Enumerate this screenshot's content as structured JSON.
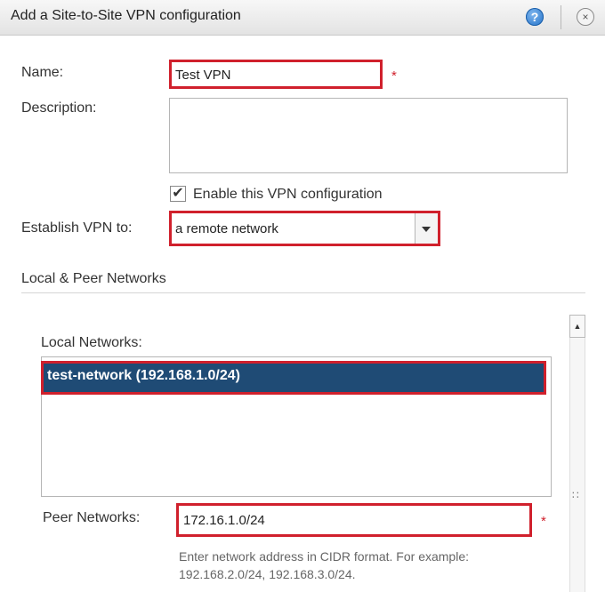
{
  "dialog": {
    "title": "Add a Site-to-Site VPN configuration",
    "help_icon_glyph": "?",
    "close_icon_glyph": "×"
  },
  "form": {
    "name_label": "Name:",
    "name_value": "Test VPN",
    "required_mark": "*",
    "description_label": "Description:",
    "description_value": "",
    "enable_checked": true,
    "enable_label": "Enable this VPN configuration",
    "establish_label": "Establish VPN to:",
    "establish_value": "a remote network"
  },
  "networks": {
    "section_title": "Local & Peer Networks",
    "local_label": "Local Networks:",
    "local_items": [
      "test-network (192.168.1.0/24)"
    ],
    "peer_label": "Peer Networks:",
    "peer_value": "172.16.1.0/24",
    "help_line1": "Enter network address in CIDR format. For example:",
    "help_line2": "192.168.2.0/24, 192.168.3.0/24."
  },
  "icons": {
    "help": "help-icon",
    "close": "close-icon",
    "dropdown": "chevron-down-icon",
    "check": "checkmark-icon"
  },
  "colors": {
    "highlight_border": "#d0202c",
    "selection_bg": "#1f4b75"
  }
}
